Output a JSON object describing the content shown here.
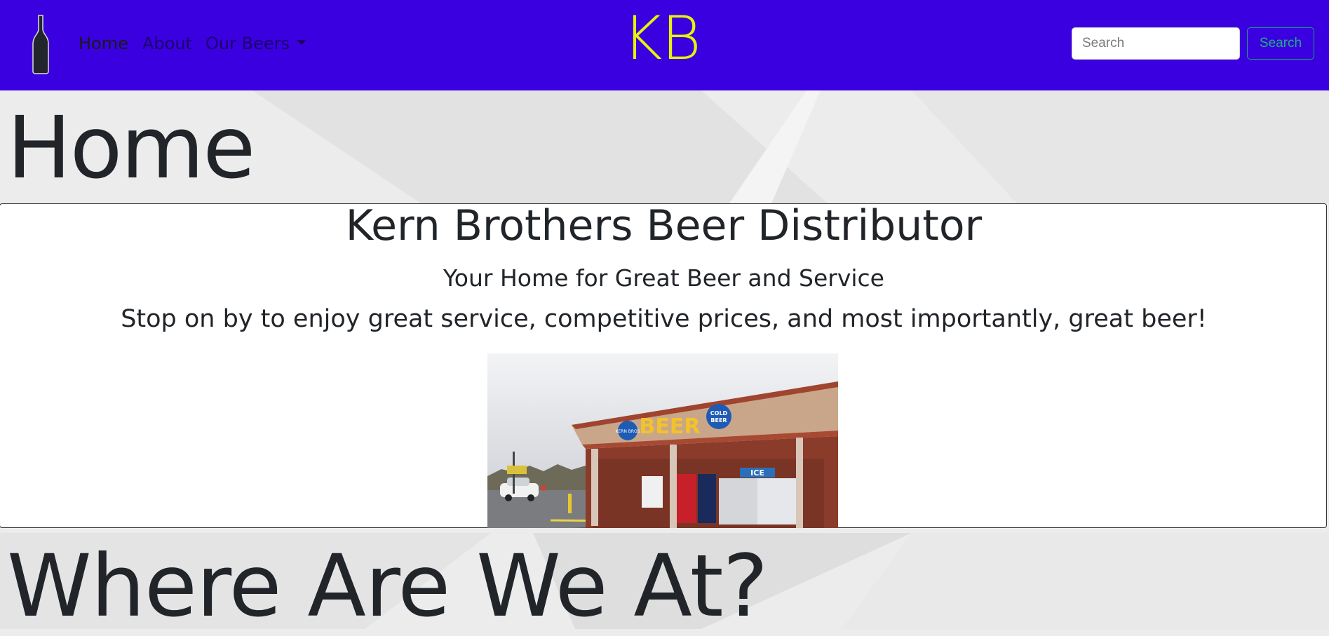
{
  "nav": {
    "logo_icon": "beer-bottle-icon",
    "links": [
      {
        "label": "Home"
      },
      {
        "label": "About"
      },
      {
        "label": "Our Beers"
      }
    ],
    "brand": "KB",
    "search": {
      "placeholder": "Search",
      "button_label": "Search"
    },
    "colors": {
      "navbar_bg": "#3a00e0",
      "brand_text": "#e9f20a",
      "search_button": "#20b07e"
    }
  },
  "page": {
    "title": "Home"
  },
  "card": {
    "title": "Kern Brothers Beer Distributor",
    "subtitle": "Your Home for Great Beer and Service",
    "text": "Stop on by to enjoy great service, competitive prices, and most importantly, great beer!",
    "image": {
      "sign_text": "BEER",
      "badge_left": "KERN BROS",
      "badge_right_line1": "COLD",
      "badge_right_line2": "BEER",
      "ice_text": "ICE"
    }
  },
  "section": {
    "title": "Where Are We At?"
  }
}
